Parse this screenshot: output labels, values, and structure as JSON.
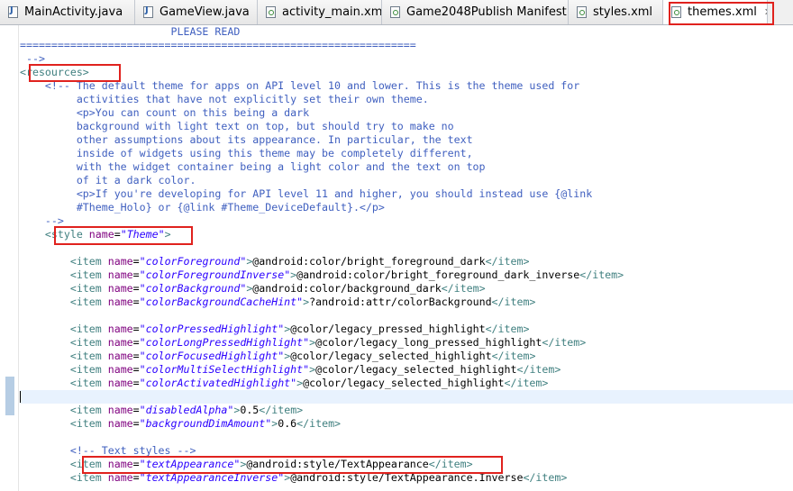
{
  "tabs": [
    {
      "label": "MainActivity.java",
      "type": "java",
      "active": false
    },
    {
      "label": "GameView.java",
      "type": "java",
      "active": false
    },
    {
      "label": "activity_main.xml",
      "type": "xml",
      "active": false
    },
    {
      "label": "Game2048Publish Manifest",
      "type": "xml",
      "active": false
    },
    {
      "label": "styles.xml",
      "type": "xml",
      "active": false
    },
    {
      "label": "themes.xml",
      "type": "xml",
      "active": true,
      "close_label": "✕"
    }
  ],
  "code": {
    "lines": [
      {
        "text": "                        PLEASE READ",
        "kind": "cmt"
      },
      {
        "text": "===============================================================",
        "kind": "cmt"
      },
      {
        "text": " -->",
        "kind": "cmt"
      },
      {
        "text": "<resources>",
        "kind": "tag"
      },
      {
        "text": "    <!-- The default theme for apps on API level 10 and lower. This is the theme used for",
        "kind": "cmt"
      },
      {
        "text": "         activities that have not explicitly set their own theme.",
        "kind": "cmt"
      },
      {
        "text": "         <p>You can count on this being a dark",
        "kind": "cmt"
      },
      {
        "text": "         background with light text on top, but should try to make no",
        "kind": "cmt"
      },
      {
        "text": "         other assumptions about its appearance. In particular, the text",
        "kind": "cmt"
      },
      {
        "text": "         inside of widgets using this theme may be completely different,",
        "kind": "cmt"
      },
      {
        "text": "         with the widget container being a light color and the text on top",
        "kind": "cmt"
      },
      {
        "text": "         of it a dark color.",
        "kind": "cmt"
      },
      {
        "text": "         <p>If you're developing for API level 11 and higher, you should instead use {@link",
        "kind": "cmt"
      },
      {
        "text": "         #Theme_Holo} or {@link #Theme_DeviceDefault}.</p>",
        "kind": "cmt"
      },
      {
        "text": "    -->",
        "kind": "cmt"
      },
      {
        "kind": "style",
        "indent": "    ",
        "name": "Theme"
      },
      {
        "text": "",
        "kind": "blank"
      },
      {
        "kind": "item",
        "name": "colorForeground",
        "value": "@android:color/bright_foreground_dark"
      },
      {
        "kind": "item",
        "name": "colorForegroundInverse",
        "value": "@android:color/bright_foreground_dark_inverse"
      },
      {
        "kind": "item",
        "name": "colorBackground",
        "value": "@android:color/background_dark"
      },
      {
        "kind": "item",
        "name": "colorBackgroundCacheHint",
        "value": "?android:attr/colorBackground"
      },
      {
        "text": "",
        "kind": "blank"
      },
      {
        "kind": "item",
        "name": "colorPressedHighlight",
        "value": "@color/legacy_pressed_highlight"
      },
      {
        "kind": "item",
        "name": "colorLongPressedHighlight",
        "value": "@color/legacy_long_pressed_highlight"
      },
      {
        "kind": "item",
        "name": "colorFocusedHighlight",
        "value": "@color/legacy_selected_highlight"
      },
      {
        "kind": "item",
        "name": "colorMultiSelectHighlight",
        "value": "@color/legacy_selected_highlight"
      },
      {
        "kind": "item",
        "name": "colorActivatedHighlight",
        "value": "@color/legacy_selected_highlight"
      },
      {
        "text": "",
        "kind": "current"
      },
      {
        "kind": "item",
        "name": "disabledAlpha",
        "value": "0.5"
      },
      {
        "kind": "item",
        "name": "backgroundDimAmount",
        "value": "0.6"
      },
      {
        "text": "",
        "kind": "blank"
      },
      {
        "text": "        <!-- Text styles -->",
        "kind": "cmt"
      },
      {
        "kind": "item",
        "name": "textAppearance",
        "value": "@android:style/TextAppearance"
      },
      {
        "kind": "item",
        "name": "textAppearanceInverse",
        "value": "@android:style/TextAppearance.Inverse"
      }
    ]
  },
  "colors": {
    "comment": "#3f5fbf",
    "tag": "#3f7f7f",
    "attribute": "#7f007f",
    "attribute_value": "#2a00ff",
    "highlight_box": "#e0221e",
    "current_line": "#e8f2fe"
  }
}
